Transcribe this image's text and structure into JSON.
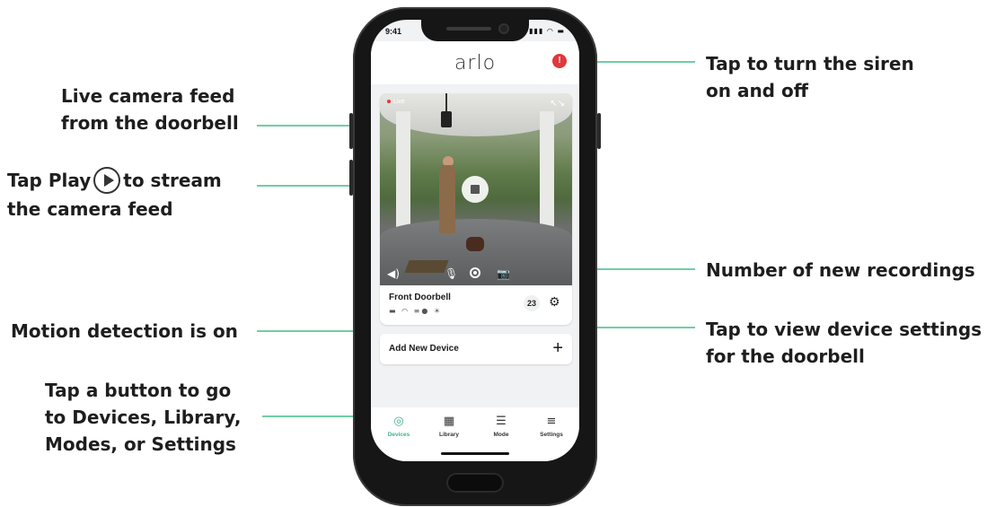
{
  "callouts": {
    "live_feed": [
      "Live camera feed",
      "from the doorbell"
    ],
    "tap_play_pre": "Tap Play",
    "tap_play_post": "to stream",
    "tap_play_line2": "the camera feed",
    "motion": "Motion detection is on",
    "nav": [
      "Tap a button to go",
      "to Devices, Library,",
      "Modes, or Settings"
    ],
    "siren": [
      "Tap to turn the siren",
      "on and off"
    ],
    "recordings": "Number of new recordings",
    "settings": [
      "Tap to view device settings",
      "for the doorbell"
    ]
  },
  "phone": {
    "status_time": "9:41",
    "status_icons": "▮▮▮ ◠ ▬",
    "logo": "arlo",
    "siren_icon": "siren-icon",
    "feed": {
      "live_label": "Live",
      "expand_icon": "↖↘"
    },
    "device": {
      "name": "Front Doorbell",
      "icons": "▬ ◠ ≡● ☀",
      "new_recordings": "23"
    },
    "add_device_label": "Add New Device",
    "add_icon": "+",
    "tabs": [
      {
        "label": "Devices",
        "icon": "◎",
        "active": true
      },
      {
        "label": "Library",
        "icon": "▦"
      },
      {
        "label": "Mode",
        "icon": "☰"
      },
      {
        "label": "Settings",
        "icon": "≡"
      }
    ]
  },
  "colors": {
    "callout_line": "#6fcea6",
    "siren": "#e0383c",
    "active_tab": "#3fb389"
  }
}
